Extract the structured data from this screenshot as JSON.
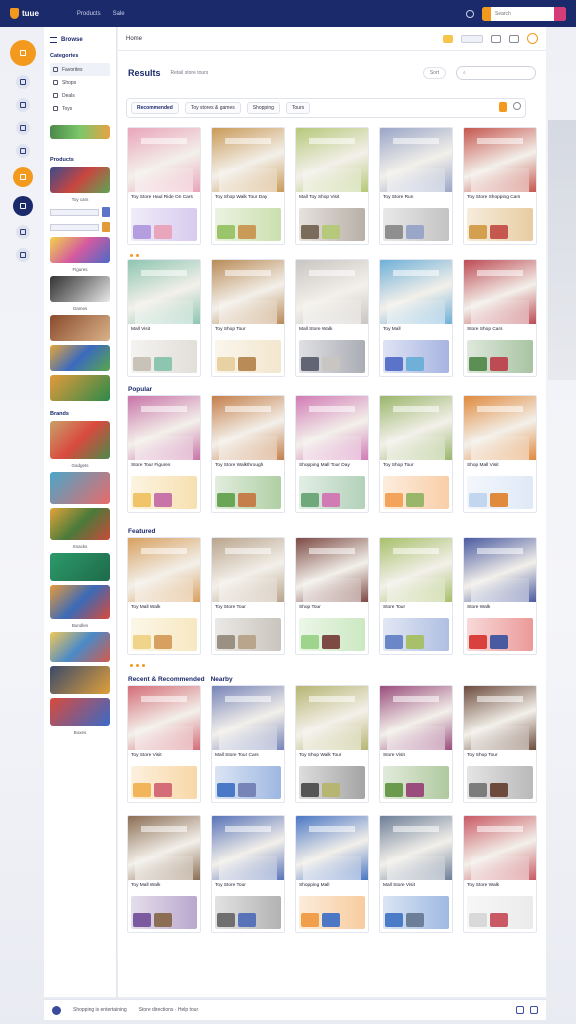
{
  "app": {
    "logo_text": "tuue"
  },
  "topbar": {
    "nav": [
      "Products",
      "Sale"
    ],
    "search_placeholder": "Search"
  },
  "sidebar": {
    "title": "Browse",
    "section_categories": "Categories",
    "items": [
      "Favorites",
      "Shops",
      "Deals",
      "Toys"
    ],
    "section_products": "Products",
    "section_brands": "Brands",
    "caption_1": "Toy cars",
    "caption_2": "Figures",
    "caption_3": "Games",
    "caption_4": "Gadgets",
    "caption_5": "Snacks",
    "caption_6": "Bundles",
    "caption_7": "Boxes"
  },
  "main": {
    "breadcrumb": "Home",
    "header": {
      "title": "Results",
      "subtitle": "Retail store tours",
      "sort": "Sort"
    },
    "filters": [
      "Recommended",
      "Toy stores & games",
      "Shopping",
      "Tours"
    ],
    "sections": [
      {
        "title": "",
        "rows": 2
      },
      {
        "title": "Popular"
      },
      {
        "title": "Featured"
      },
      {
        "title": "Recent & Recommended",
        "aside": "Nearby"
      },
      {
        "title": ""
      }
    ]
  },
  "cards": [
    [
      "Toy Store Haul Ride On Cars",
      "#e9a5bb",
      "#b49ee0"
    ],
    [
      "Toy Shop Walk Tour Day",
      "#c99a58",
      "#9cc46a"
    ],
    [
      "Mall Toy Shop Visit",
      "#b6c879",
      "#7b6b5a"
    ],
    [
      "Toy Store Run",
      "#9aa6c8",
      "#8f8f8f"
    ],
    [
      "Toy Store Shopping Cars",
      "#c5574f",
      "#d4a050"
    ],
    [
      "Mall Visit",
      "#8ec5b1",
      "#c9c2b8"
    ],
    [
      "Toy Shop Tour",
      "#b98b57",
      "#e8d1a3"
    ],
    [
      "Mall Store Walk",
      "#c9c5c2",
      "#616574"
    ],
    [
      "Toy Mall",
      "#6fb0d8",
      "#5b73c8"
    ],
    [
      "Store Shop Cars",
      "#bd4b54",
      "#5c8f53"
    ],
    [
      "Store Tour Figures",
      "#c874a8",
      "#f0c56a"
    ],
    [
      "Toy Store Walkthrough",
      "#c47f4a",
      "#6aa656"
    ],
    [
      "Shopping Mall Tour Day",
      "#d17bb5",
      "#6fa97b"
    ],
    [
      "Toy Shop Tour",
      "#9ab66b",
      "#f3a45a"
    ],
    [
      "Shop Mall Visit",
      "#e08a3e",
      "#c2d6ef"
    ],
    [
      "Toy Mall Walk",
      "#d8a060",
      "#efd48a"
    ],
    [
      "Toy Store Tour",
      "#b9a48c",
      "#9a9183"
    ],
    [
      "Shop Tour",
      "#7d4a44",
      "#9fd48c"
    ],
    [
      "Store Tour",
      "#a8c06a",
      "#6b87c8"
    ],
    [
      "Store Walk",
      "#4a5aa0",
      "#d9413f"
    ],
    [
      "Toy Store Visit",
      "#d46d78",
      "#f2b55a"
    ],
    [
      "Mall Store Tour Cars",
      "#7784b8",
      "#4a79c8"
    ],
    [
      "Toy Shop Walk Tour",
      "#b6b572",
      "#555555"
    ],
    [
      "Store Visit",
      "#9a4d7d",
      "#6b9a4c"
    ],
    [
      "Toy Shop Tour",
      "#6c4b3c",
      "#7c7c7c"
    ],
    [
      "Toy Mall Walk",
      "#8b6e54",
      "#7c5aa0"
    ],
    [
      "Toy Store Tour",
      "#5873b8",
      "#6f6f6f"
    ],
    [
      "Shopping Mall",
      "#4b77c4",
      "#f0a04a"
    ],
    [
      "Mall Store Visit",
      "#6d7f98",
      "#4a7cc8"
    ],
    [
      "Toy Store Walk",
      "#c95a64",
      "#d9d9d9"
    ]
  ],
  "footer": {
    "left": "Shopping is entertaining",
    "right": "Store directions · Help tour"
  }
}
